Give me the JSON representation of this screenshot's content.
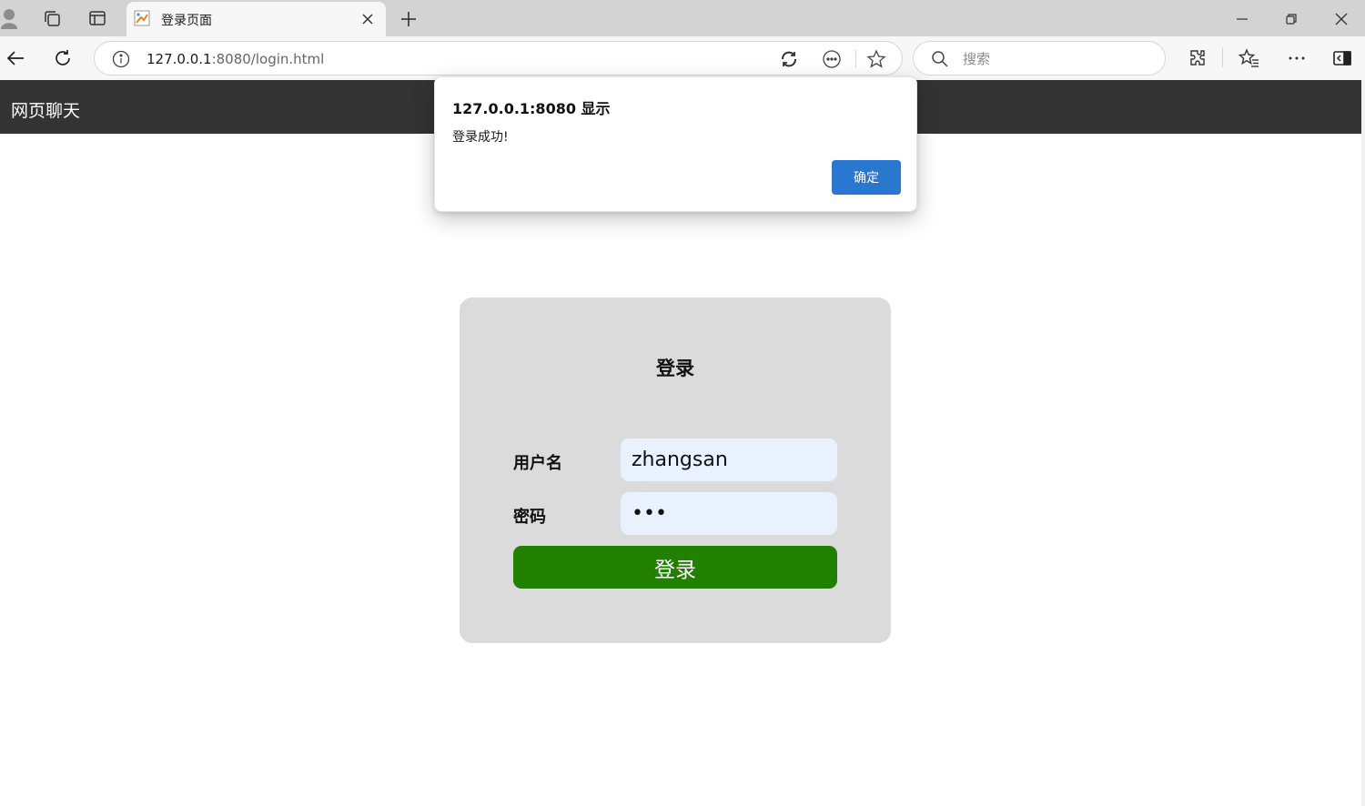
{
  "browser": {
    "tab": {
      "title": "登录页面"
    },
    "address": {
      "host": "127.0.0.1",
      "path": ":8080/login.html"
    },
    "search": {
      "placeholder": "搜索"
    }
  },
  "page": {
    "site_title": "网页聊天",
    "login": {
      "title": "登录",
      "username_label": "用户名",
      "username_value": "zhangsan",
      "password_label": "密码",
      "password_value": "•••",
      "submit_label": "登录"
    }
  },
  "alert": {
    "title": "127.0.0.1:8080 显示",
    "message": "登录成功!",
    "ok_label": "确定"
  },
  "colors": {
    "header_bg": "#333333",
    "card_bg": "#dbdbdb",
    "input_bg": "#e9f0fe",
    "login_button": "#228000",
    "ok_button": "#2a77d0"
  },
  "icons": [
    "profile-icon",
    "collections-icon",
    "tab-actions-icon",
    "favicon-icon",
    "close-icon",
    "plus-icon",
    "minimize-icon",
    "restore-icon",
    "window-close-icon",
    "back-icon",
    "refresh-icon",
    "info-icon",
    "translate-icon",
    "reading-mode-icon",
    "star-icon",
    "search-icon",
    "extensions-icon",
    "favorites-icon",
    "more-icon",
    "sidebar-icon"
  ]
}
